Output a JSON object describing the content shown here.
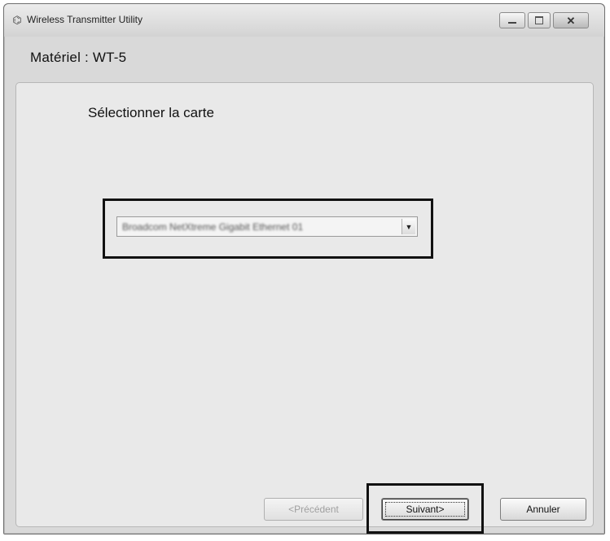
{
  "window": {
    "title": "Wireless Transmitter Utility",
    "icon": "app-icon"
  },
  "header": {
    "hardware_label": "Matériel : WT-5"
  },
  "main": {
    "heading": "Sélectionner la carte",
    "card_select": {
      "value": "Broadcom NetXtreme Gigabit Ethernet 01",
      "options_visible": [
        "Broadcom NetXtreme Gigabit Ethernet 01"
      ]
    }
  },
  "buttons": {
    "previous": "<Précédent",
    "next": "Suivant>",
    "cancel": "Annuler"
  },
  "colors": {
    "window_bg": "#d9d9d9",
    "panel_bg": "#e9e9e9",
    "highlight_border": "#111111"
  }
}
